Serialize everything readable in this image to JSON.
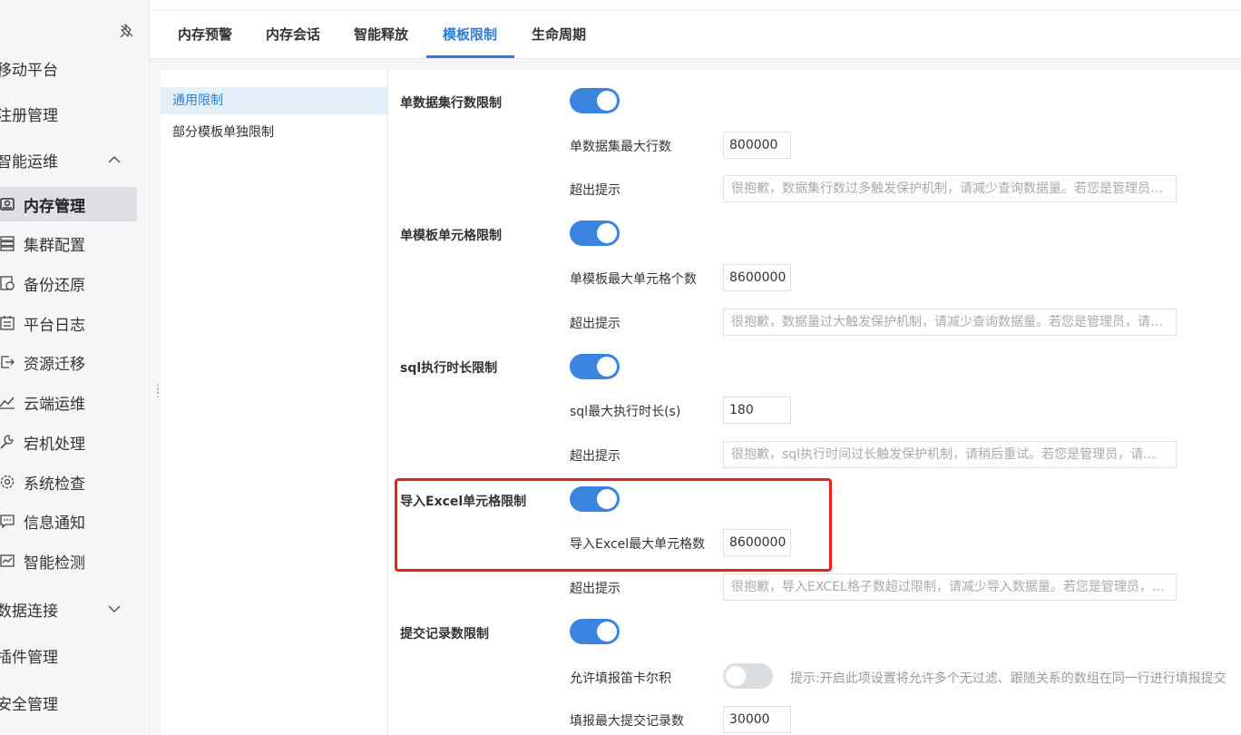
{
  "sidebar": {
    "top_items": [
      {
        "label": "移动平台"
      },
      {
        "label": "注册管理"
      },
      {
        "label": "智能运维"
      },
      {
        "label": "数据连接"
      },
      {
        "label": "插件管理"
      },
      {
        "label": "安全管理"
      }
    ],
    "sub_items": [
      {
        "label": "内存管理",
        "icon": "memory-icon",
        "active": true
      },
      {
        "label": "集群配置",
        "icon": "server-icon"
      },
      {
        "label": "备份还原",
        "icon": "backup-icon"
      },
      {
        "label": "平台日志",
        "icon": "log-icon"
      },
      {
        "label": "资源迁移",
        "icon": "migrate-icon"
      },
      {
        "label": "云端运维",
        "icon": "cloud-ops-icon"
      },
      {
        "label": "宕机处理",
        "icon": "wrench-icon"
      },
      {
        "label": "系统检查",
        "icon": "gear-icon"
      },
      {
        "label": "信息通知",
        "icon": "message-icon"
      },
      {
        "label": "智能检测",
        "icon": "detect-icon"
      }
    ]
  },
  "tabs": [
    {
      "label": "内存预警"
    },
    {
      "label": "内存会话"
    },
    {
      "label": "智能释放"
    },
    {
      "label": "模板限制",
      "active": true
    },
    {
      "label": "生命周期"
    }
  ],
  "subnav": [
    {
      "label": "通用限制",
      "active": true
    },
    {
      "label": "部分模板单独限制"
    }
  ],
  "settings": {
    "dataset_rows": {
      "label": "单数据集行数限制",
      "enabled": true,
      "max_label": "单数据集最大行数",
      "max_value": "800000",
      "tip_label": "超出提示",
      "tip_value": "很抱歉，数据集行数过多触发保护机制，请减少查询数据量。若您是管理员，请联系技术支持。"
    },
    "template_cells": {
      "label": "单模板单元格限制",
      "enabled": true,
      "max_label": "单模板最大单元格个数",
      "max_value": "8600000",
      "tip_label": "超出提示",
      "tip_value": "很抱歉，数据量过大触发保护机制，请减少查询数据量。若您是管理员，请联系技术支持。"
    },
    "sql_time": {
      "label": "sql执行时长限制",
      "enabled": true,
      "max_label": "sql最大执行时长(s)",
      "max_value": "180",
      "tip_label": "超出提示",
      "tip_value": "很抱歉，sql执行时间过长触发保护机制，请稍后重试。若您是管理员，请联系技术支持。"
    },
    "excel_cells": {
      "label": "导入Excel单元格限制",
      "enabled": true,
      "max_label": "导入Excel最大单元格数",
      "max_value": "8600000",
      "tip_label": "超出提示",
      "tip_value": "很抱歉，导入EXCEL格子数超过限制，请减少导入数据量。若您是管理员，请联系技术支持。"
    },
    "submit_records": {
      "label": "提交记录数限制",
      "enabled": true,
      "cartesian_label": "允许填报笛卡尔积",
      "cartesian_enabled": false,
      "cartesian_hint": "提示:开启此项设置将允许多个无过滤、跟随关系的数组在同一行进行填报提交",
      "max_label": "填报最大提交记录数",
      "max_value": "30000"
    }
  },
  "colors": {
    "accent": "#2f7dd9",
    "toggle_on": "#3b84e0",
    "highlight": "#e8211a"
  }
}
